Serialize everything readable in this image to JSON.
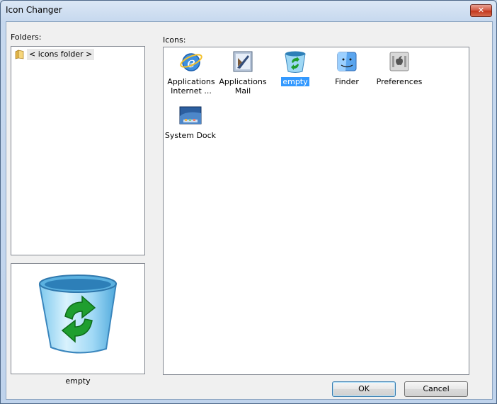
{
  "window": {
    "title": "Icon Changer",
    "close_glyph": "✕"
  },
  "folders": {
    "label": "Folders:",
    "items": [
      {
        "label": "< icons folder >",
        "icon": "folder-icon"
      }
    ]
  },
  "preview": {
    "caption": "empty",
    "icon": "recycle-bin-icon"
  },
  "icons": {
    "label": "Icons:",
    "items": [
      {
        "line1": "Applications",
        "line2": "Internet ...",
        "icon": "internet-explorer-icon",
        "selected": false
      },
      {
        "line1": "Applications",
        "line2": "Mail",
        "icon": "mail-icon",
        "selected": false
      },
      {
        "line1": "empty",
        "line2": "",
        "icon": "recycle-bin-icon",
        "selected": true
      },
      {
        "line1": "Finder",
        "line2": "",
        "icon": "finder-icon",
        "selected": false
      },
      {
        "line1": "Preferences",
        "line2": "",
        "icon": "preferences-icon",
        "selected": false
      },
      {
        "line1": "System Dock",
        "line2": "",
        "icon": "system-dock-icon",
        "selected": false
      }
    ]
  },
  "buttons": {
    "ok": "OK",
    "cancel": "Cancel"
  },
  "colors": {
    "selection": "#3399ff",
    "client_bg": "#f0f0f0",
    "frame": "#c6d8ee",
    "bin_green": "#1f9e2f"
  }
}
